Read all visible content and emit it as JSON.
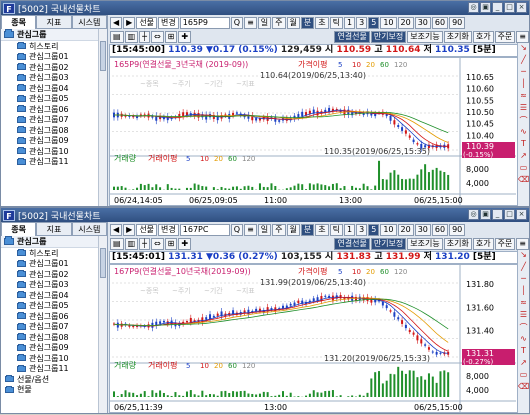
{
  "colors": {
    "up": "#d21616",
    "down": "#1a3fc4",
    "badge": "#c81e6e",
    "volume": "#1f8f2a"
  },
  "left_panel": {
    "tabs": [
      "종목",
      "지표",
      "시스템"
    ],
    "group_title": "관심그룹",
    "items": [
      "히스토리",
      "관심그룹01",
      "관심그룹02",
      "관심그룹03",
      "관심그룹04",
      "관심그룹05",
      "관심그룹06",
      "관심그룹07",
      "관심그룹08",
      "관심그룹09",
      "관심그룹10",
      "관심그룹11"
    ],
    "extra_items": [
      "선물/옵션",
      "현물"
    ]
  },
  "windows": [
    {
      "title": "[5002] 국내선물차트",
      "toolbar": {
        "select1": "선물",
        "select2": "변경",
        "code": "165P9",
        "periods": [
          "일",
          "주",
          "월",
          "분",
          "초",
          "틱"
        ],
        "active_period": "분",
        "nums": [
          "1",
          "3",
          "5",
          "10",
          "20",
          "30",
          "60",
          "90",
          "5"
        ],
        "active_num": "5"
      },
      "toolbar2": {
        "connected": "연결선물",
        "expiry": "만기보정",
        "aux": "보조기능",
        "init": "초기화",
        "quote_btn": "호가",
        "order_btn": "주문"
      },
      "quote": {
        "time": "[15:45:00]",
        "price": "110.39",
        "change": "▼0.17",
        "pct": "(0.15%)",
        "volume": "129,459",
        "high_label": "시",
        "high_val": "110.59",
        "hi_label": "고",
        "hi_val": "110.64",
        "lo_label": "저",
        "lo_val": "110.35",
        "interval": "[5분]"
      },
      "chart": {
        "legend": "165P9(연결선물_3년국채 (2019-09))",
        "ma_label": "가격이평",
        "ma_items": [
          "5",
          "10",
          "20",
          "60",
          "120"
        ],
        "hi_note": "110.64(2019/06/25,13:40)",
        "lo_note": "110.35(2019/06/25,15:35)",
        "y_ticks": [
          "110.65",
          "110.60",
          "110.55",
          "110.50",
          "110.45",
          "110.40"
        ],
        "last": "110.39",
        "last_pct": "(-0.15%)",
        "vol_label": "거래량",
        "vol_ma_label": "거래이평",
        "vol_ticks": [
          "8,000",
          "4,000"
        ],
        "x_ticks": [
          "06/24,14:05",
          "06/25,09:05",
          "11:00",
          "13:00",
          "06/25,15:00"
        ],
        "ghost": [
          "~종목",
          "~주기",
          "~기간",
          "~지표"
        ]
      }
    },
    {
      "title": "[5002] 국내선물차트",
      "toolbar": {
        "select1": "선물",
        "select2": "변경",
        "code": "167PC",
        "periods": [
          "일",
          "주",
          "월",
          "분",
          "초",
          "틱"
        ],
        "active_period": "분",
        "nums": [
          "1",
          "3",
          "5",
          "10",
          "20",
          "30",
          "60",
          "90",
          "5"
        ],
        "active_num": "5"
      },
      "toolbar2": {
        "connected": "연결선물",
        "expiry": "만기보정",
        "aux": "보조기능",
        "init": "초기화",
        "quote_btn": "호가",
        "order_btn": "주문"
      },
      "quote": {
        "time": "[15:45:01]",
        "price": "131.31",
        "change": "▼0.36",
        "pct": "(0.27%)",
        "volume": "103,155",
        "high_label": "시",
        "high_val": "131.83",
        "hi_label": "고",
        "hi_val": "131.99",
        "lo_label": "저",
        "lo_val": "131.20",
        "interval": "[5분]"
      },
      "chart": {
        "legend": "167P9(연결선물_10년국채(2019-09))",
        "ma_label": "가격이평",
        "ma_items": [
          "5",
          "10",
          "20",
          "60",
          "120"
        ],
        "hi_note": "131.99(2019/06/25,13:40)",
        "lo_note": "131.20(2019/06/25,15:33)",
        "y_ticks": [
          "131.80",
          "131.60",
          "131.40"
        ],
        "last": "131.31",
        "last_pct": "(-0.27%)",
        "vol_label": "거래량",
        "vol_ma_label": "거래이평",
        "vol_ticks": [
          "8,000",
          "4,000"
        ],
        "x_ticks": [
          "06/25,11:39",
          "13:00",
          "06/25,15:00"
        ],
        "ghost": [
          "~종목",
          "~주기",
          "~기간",
          "~지표"
        ]
      }
    }
  ]
}
